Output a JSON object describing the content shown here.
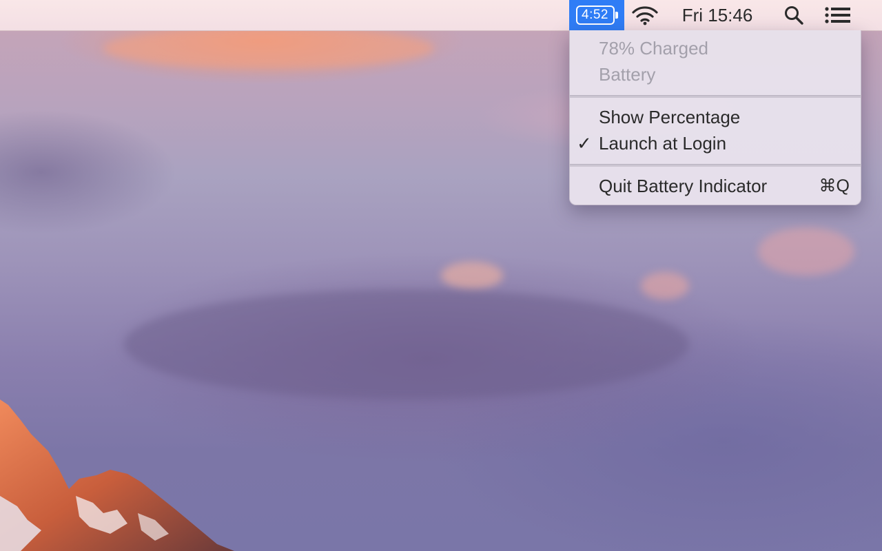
{
  "menubar": {
    "battery_time": "4:52",
    "clock": "Fri 15:46",
    "icons": {
      "battery": "battery-icon",
      "wifi": "wifi-icon",
      "search": "spotlight-search-icon",
      "notifications": "notification-center-icon"
    },
    "accent_color": "#2f7df6"
  },
  "battery_menu": {
    "status_charge": "78% Charged",
    "status_source": "Battery",
    "show_percentage_label": "Show Percentage",
    "launch_at_login_label": "Launch at Login",
    "launch_at_login_checked": true,
    "check_mark": "✓",
    "quit_label": "Quit Battery Indicator",
    "quit_shortcut": "⌘Q"
  }
}
